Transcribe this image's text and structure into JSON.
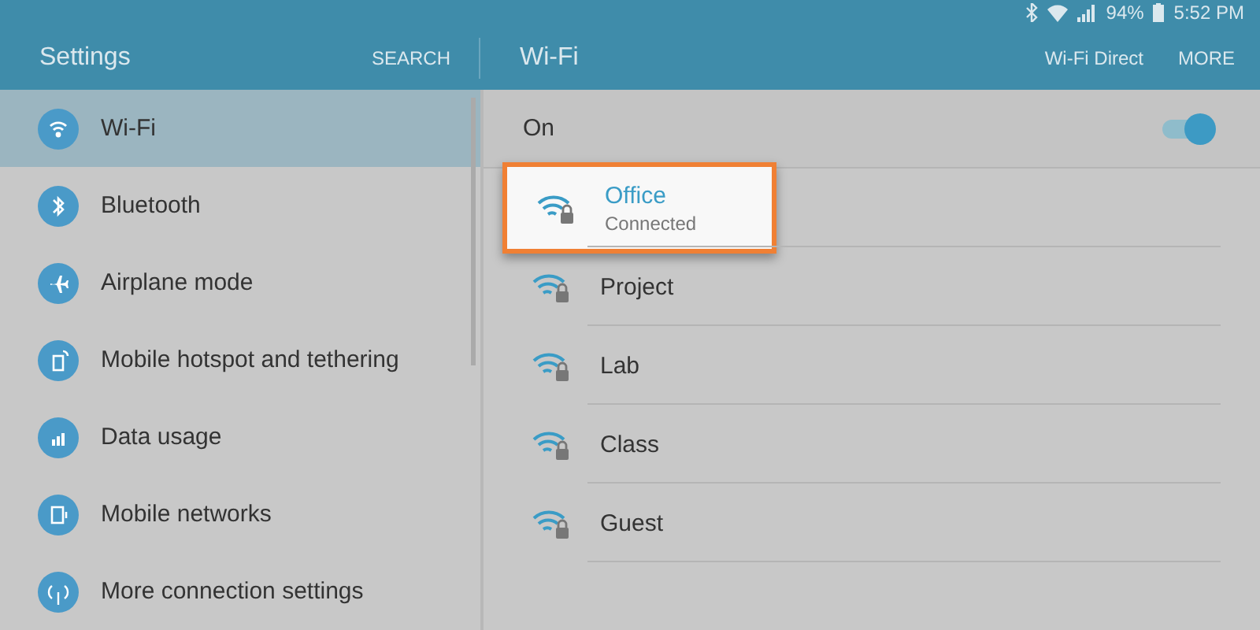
{
  "status_bar": {
    "battery": "94%",
    "time": "5:52 PM"
  },
  "header": {
    "title": "Settings",
    "search": "SEARCH",
    "page_title": "Wi-Fi",
    "actions": [
      "Wi-Fi Direct",
      "MORE"
    ]
  },
  "sidebar": {
    "items": [
      {
        "label": "Wi-Fi",
        "kind": "wifi",
        "selected": true
      },
      {
        "label": "Bluetooth",
        "kind": "bluetooth",
        "selected": false
      },
      {
        "label": "Airplane mode",
        "kind": "airplane",
        "selected": false
      },
      {
        "label": "Mobile hotspot and tethering",
        "kind": "hotspot",
        "selected": false
      },
      {
        "label": "Data usage",
        "kind": "data",
        "selected": false
      },
      {
        "label": "Mobile networks",
        "kind": "mobile",
        "selected": false
      },
      {
        "label": "More connection settings",
        "kind": "more",
        "selected": false
      }
    ]
  },
  "wifi": {
    "label": "On",
    "on": true,
    "networks": [
      {
        "name": "Office",
        "status": "Connected",
        "highlighted": true
      },
      {
        "name": "Project",
        "highlighted": false
      },
      {
        "name": "Lab",
        "highlighted": false
      },
      {
        "name": "Class",
        "highlighted": false
      },
      {
        "name": "Guest",
        "highlighted": false
      }
    ]
  }
}
